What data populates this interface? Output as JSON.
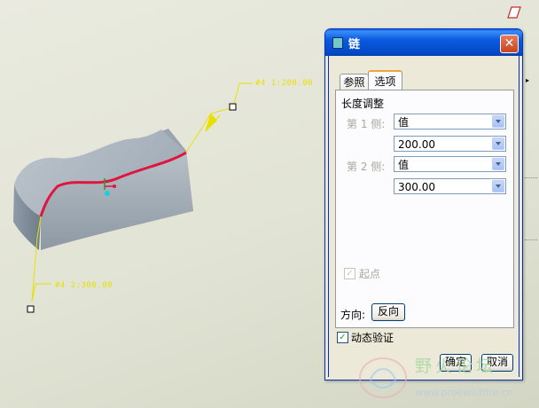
{
  "viewport": {
    "dim1_label": "#4 1:200.00",
    "dim2_label": "#4 2:300.00",
    "side_menu_arrow": "▸"
  },
  "dialog": {
    "title": "链",
    "close_label": "✕",
    "tabs": [
      "参照",
      "选项"
    ],
    "active_tab": "选项",
    "section_title": "长度调整",
    "side1_label": "第 1 侧:",
    "side1_type": "值",
    "side1_value": "200.00",
    "side2_label": "第 2 侧:",
    "side2_type": "值",
    "side2_value": "300.00",
    "start_point_label": "起点",
    "start_point_checked": true,
    "direction_label": "方向:",
    "flip_button": "反向",
    "dynamic_verify_label": "动态验证",
    "dynamic_verify_checked": true,
    "ok_button": "确定",
    "cancel_button": "取消"
  },
  "watermark": {
    "text": "野火论坛",
    "url": "www.proewildfire.cn"
  },
  "colors": {
    "model_fill": "#a9b3bd",
    "highlight_edge": "#e0153c",
    "dimension": "#e8e000",
    "title_bar": "#0a5ae0"
  }
}
